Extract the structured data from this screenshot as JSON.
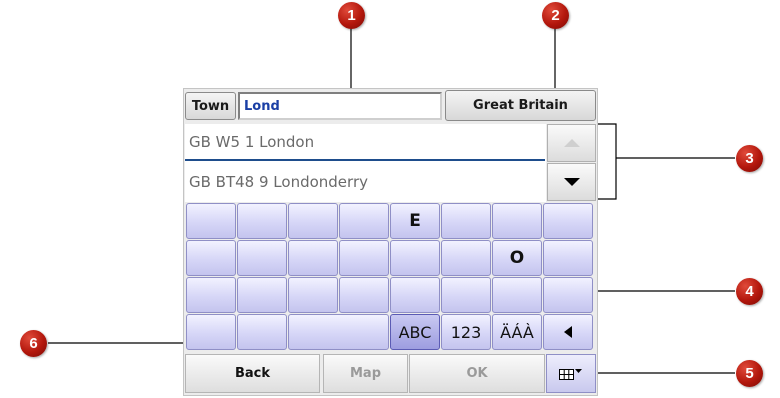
{
  "callouts": [
    "1",
    "2",
    "3",
    "4",
    "5",
    "6"
  ],
  "search": {
    "field_label": "Town",
    "value": "Lond",
    "country_button": "Great Britain"
  },
  "results": [
    "GB W5 1 London",
    "GB BT48 9 Londonderry"
  ],
  "scroll": {
    "up_icon": "triangle-up-icon",
    "down_icon": "triangle-down-icon"
  },
  "keyboard": {
    "rows": [
      [
        "",
        "",
        "",
        "",
        "E",
        "",
        "",
        ""
      ],
      [
        "",
        "",
        "",
        "",
        "",
        "",
        "O",
        ""
      ],
      [
        "",
        "",
        "",
        "",
        "",
        "",
        "",
        ""
      ]
    ],
    "modes": [
      "ABC",
      "123",
      "ÄÁÀ"
    ],
    "active_mode": "ABC",
    "backspace_icon": "triangle-left-icon"
  },
  "bottom_bar": {
    "back": "Back",
    "map": "Map",
    "ok": "OK",
    "keyboard_icon": "keyboard-grid-icon"
  },
  "colors": {
    "callout": "#b3170c",
    "key_fill": "#d6d6f7",
    "input_text": "#1a3fa5",
    "disabled_text": "#9a9a9a"
  }
}
